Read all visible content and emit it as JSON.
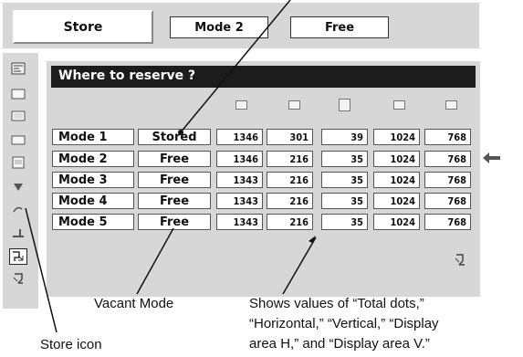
{
  "top_bar": {
    "store_tab": "Store",
    "mode_box": "Mode 2",
    "free_box": "Free"
  },
  "panel": {
    "title": "Where to reserve ?",
    "column_icons": [
      "total-dots-icon",
      "horizontal-icon",
      "vertical-icon",
      "display-area-h-icon",
      "display-area-v-icon"
    ],
    "rows": [
      {
        "mode": "Mode 1",
        "status": "Stored",
        "values": [
          "1346",
          "301",
          "39",
          "1024",
          "768"
        ]
      },
      {
        "mode": "Mode 2",
        "status": "Free",
        "values": [
          "1346",
          "216",
          "35",
          "1024",
          "768"
        ]
      },
      {
        "mode": "Mode 3",
        "status": "Free",
        "values": [
          "1343",
          "216",
          "35",
          "1024",
          "768"
        ]
      },
      {
        "mode": "Mode 4",
        "status": "Free",
        "values": [
          "1343",
          "216",
          "35",
          "1024",
          "768"
        ]
      },
      {
        "mode": "Mode 5",
        "status": "Free",
        "values": [
          "1343",
          "216",
          "35",
          "1024",
          "768"
        ]
      }
    ]
  },
  "annotations": {
    "vacant": "Vacant Mode",
    "values_line1": "Shows values of “Total dots,”",
    "values_line2": "“Horizontal,” “Vertical,” “Display",
    "values_line3": "area H,” and “Display area V.”",
    "store_icon": "Store icon"
  }
}
